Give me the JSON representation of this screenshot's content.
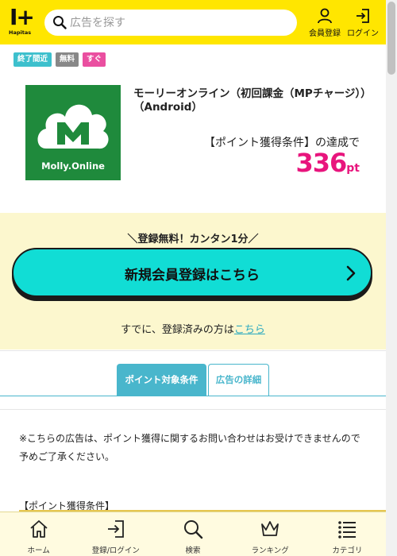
{
  "header": {
    "logo_mark": "I+",
    "logo_sub": "Hapitas",
    "search_placeholder": "広告を探す",
    "register_label": "会員登録",
    "login_label": "ログイン"
  },
  "tags": [
    "終了間近",
    "無料",
    "すぐ"
  ],
  "offer": {
    "logo_text": "Molly.Online",
    "title": "モーリーオンライン（初回課金（MPチャージ））（Android）",
    "condition": "【ポイント獲得条件】の達成で",
    "points": "336",
    "points_unit": "pt"
  },
  "register": {
    "lead": "＼登録無料！カンタン1分／",
    "button_label": "新規会員登録はこちら",
    "already_prefix": "すでに、登録済みの方は",
    "already_link": "こちら"
  },
  "tabs": [
    "ポイント対象条件",
    "広告の詳細"
  ],
  "notice": "※こちらの広告は、ポイント獲得に関するお問い合わせはお受けできませんので予めご了承ください。",
  "condition_heading": "【ポイント獲得条件】",
  "bottom_nav": [
    "ホーム",
    "登録/ログイン",
    "検索",
    "ランキング",
    "カテゴリ"
  ],
  "colors": {
    "header_bg": "#ffe600",
    "accent_pink": "#e8157d",
    "register_button": "#11ddd5",
    "tab_blue": "#49b6cc",
    "register_bg": "#fcf7ce"
  }
}
